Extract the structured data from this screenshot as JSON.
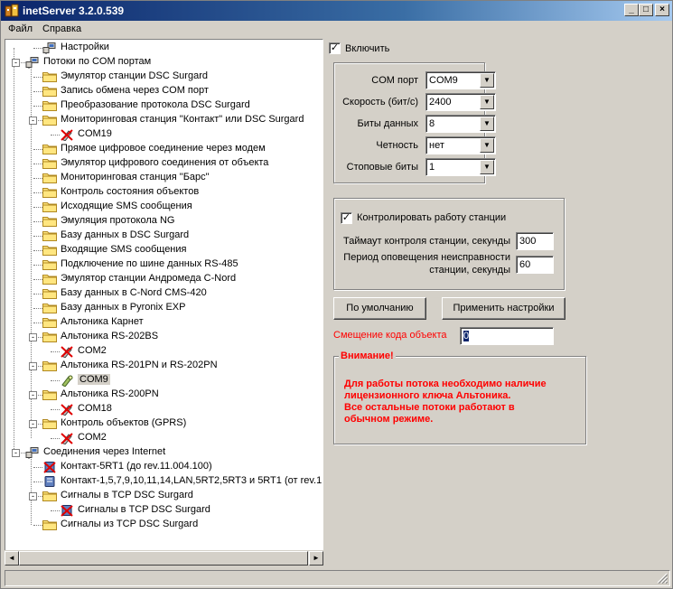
{
  "window": {
    "title": "inetServer 3.2.0.539",
    "controls": [
      "_",
      "□",
      "×"
    ]
  },
  "menu": [
    "Файл",
    "Справка"
  ],
  "tree": {
    "items": [
      {
        "text": "Настройки",
        "icon": "settings-icon"
      },
      {
        "text": "Потоки по COM портам",
        "icon": "settings-icon"
      },
      {
        "text": "Эмулятор станции DSC Surgard",
        "icon": "folder-icon"
      },
      {
        "text": "Запись обмена через COM порт",
        "icon": "folder-icon"
      },
      {
        "text": "Преобразование протокола DSC Surgard",
        "icon": "folder-icon"
      },
      {
        "text": "Мониторинговая станция \"Контакт\" или DSC Surgard",
        "icon": "folder-icon"
      },
      {
        "text": "COM19",
        "icon": "port-disabled-icon"
      },
      {
        "text": "Прямое цифровое соединение через модем",
        "icon": "folder-icon"
      },
      {
        "text": "Эмулятор цифрового соединения от объекта",
        "icon": "folder-icon"
      },
      {
        "text": "Мониторинговая станция \"Барс\"",
        "icon": "folder-icon"
      },
      {
        "text": "Контроль состояния объектов",
        "icon": "folder-icon"
      },
      {
        "text": "Исходящие SMS сообщения",
        "icon": "folder-icon"
      },
      {
        "text": "Эмуляция протокола NG",
        "icon": "folder-icon"
      },
      {
        "text": "Базу данных в DSC Surgard",
        "icon": "folder-icon"
      },
      {
        "text": "Входящие SMS сообщения",
        "icon": "folder-icon"
      },
      {
        "text": "Подключение по шине данных RS-485",
        "icon": "folder-icon"
      },
      {
        "text": "Эмулятор станции Андромеда C-Nord",
        "icon": "folder-icon"
      },
      {
        "text": "Базу данных в C-Nord CMS-420",
        "icon": "folder-icon"
      },
      {
        "text": "Базу данных в Pyronix EXP",
        "icon": "folder-icon"
      },
      {
        "text": "Альтоника Карнет",
        "icon": "folder-icon"
      },
      {
        "text": "Альтоника RS-202BS",
        "icon": "folder-icon"
      },
      {
        "text": "COM2",
        "icon": "port-disabled-icon"
      },
      {
        "text": "Альтоника RS-201PN и RS-202PN",
        "icon": "folder-icon"
      },
      {
        "text": "COM9",
        "icon": "port-enabled-icon"
      },
      {
        "text": "Альтоника RS-200PN",
        "icon": "folder-icon"
      },
      {
        "text": "COM18",
        "icon": "port-disabled-icon"
      },
      {
        "text": "Контроль объектов (GPRS)",
        "icon": "folder-icon"
      },
      {
        "text": "COM2",
        "icon": "port-disabled-icon"
      },
      {
        "text": "Соединения через Internet",
        "icon": "settings-icon"
      },
      {
        "text": "Контакт-5RT1 (до rev.11.004.100)",
        "icon": "server-disabled-icon"
      },
      {
        "text": "Контакт-1,5,7,9,10,11,14,LAN,5RT2,5RT3 и 5RT1 (от rev.1",
        "icon": "server-icon"
      },
      {
        "text": "Сигналы в TCP DSC Surgard",
        "icon": "folder-icon"
      },
      {
        "text": "Сигналы в TCP DSC Surgard",
        "icon": "server-disabled-icon"
      },
      {
        "text": "Сигналы из TCP DSC Surgard",
        "icon": "folder-icon"
      }
    ]
  },
  "settings": {
    "enable_label": "Включить",
    "enable_checked": true,
    "com_port_label": "COM порт",
    "com_port_value": "COM9",
    "speed_label": "Скорость (бит/с)",
    "speed_value": "2400",
    "data_bits_label": "Биты данных",
    "data_bits_value": "8",
    "parity_label": "Четность",
    "parity_value": "нет",
    "stop_bits_label": "Стоповые биты",
    "stop_bits_value": "1",
    "control_label": "Контролировать работу станции",
    "control_checked": true,
    "timeout_label": "Таймаут контроля станции, секунды",
    "timeout_value": "300",
    "period_label_line1": "Период оповещения неисправности",
    "period_label_line2": "станции, секунды",
    "period_value": "60",
    "default_button": "По умолчанию",
    "apply_button": "Применить настройки",
    "offset_label": "Смещение кода объекта",
    "offset_value": "0",
    "warning_title": "Внимание!",
    "warning_lines": [
      "Для работы потока необходимо наличие",
      "лицензионного ключа Альтоника.",
      "Все остальные потоки работают в",
      "обычном режиме."
    ]
  },
  "colors": {
    "titlebar_start": "#0a246a",
    "titlebar_end": "#a6caf0",
    "warning_red": "#ff0000",
    "face": "#d4d0c8"
  }
}
